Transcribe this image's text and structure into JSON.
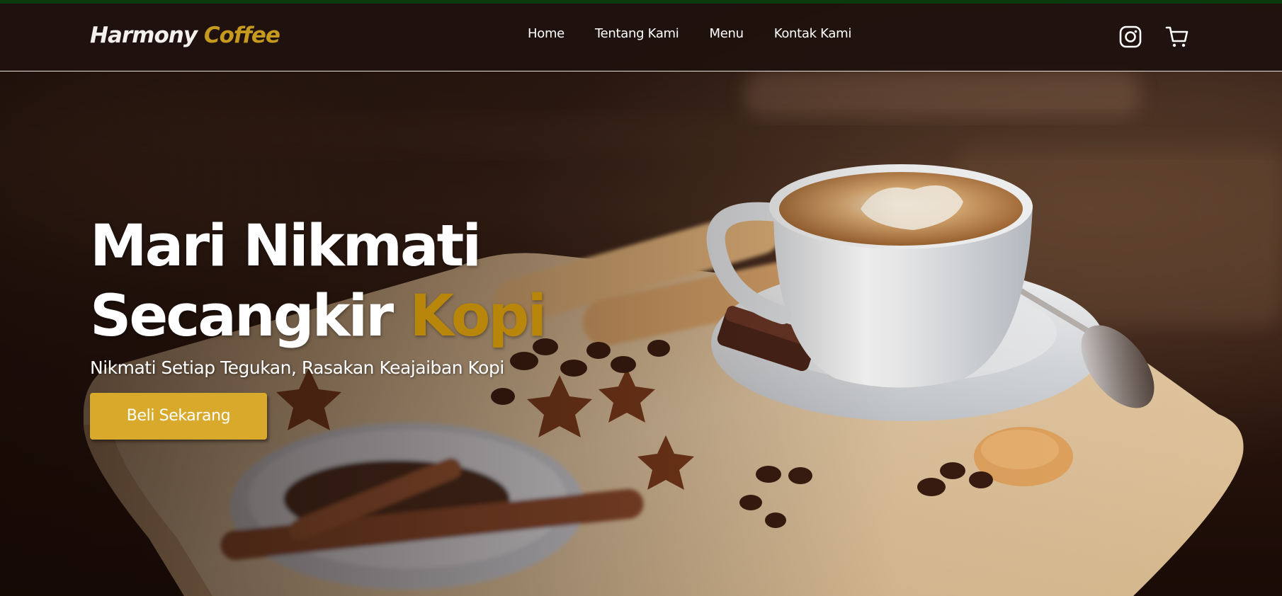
{
  "navbar": {
    "logo_primary": "Harmony",
    "logo_accent": "Coffee",
    "links": [
      "Home",
      "Tentang Kami",
      "Menu",
      "Kontak Kami"
    ],
    "icons": [
      "instagram-icon",
      "cart-icon"
    ]
  },
  "hero": {
    "title_line1": "Mari Nikmati",
    "title_line2_prefix": "Secangkir",
    "title_line2_accent": "Kopi",
    "subtitle": "Nikmati Setiap Tegukan, Rasakan Keajaiban Kopi",
    "cta_label": "Beli Sekarang"
  },
  "colors": {
    "accent_gold": "#c59a1e",
    "button": "#d8a92a",
    "navbar_bg": "#1f120e",
    "text": "#ffffff"
  }
}
